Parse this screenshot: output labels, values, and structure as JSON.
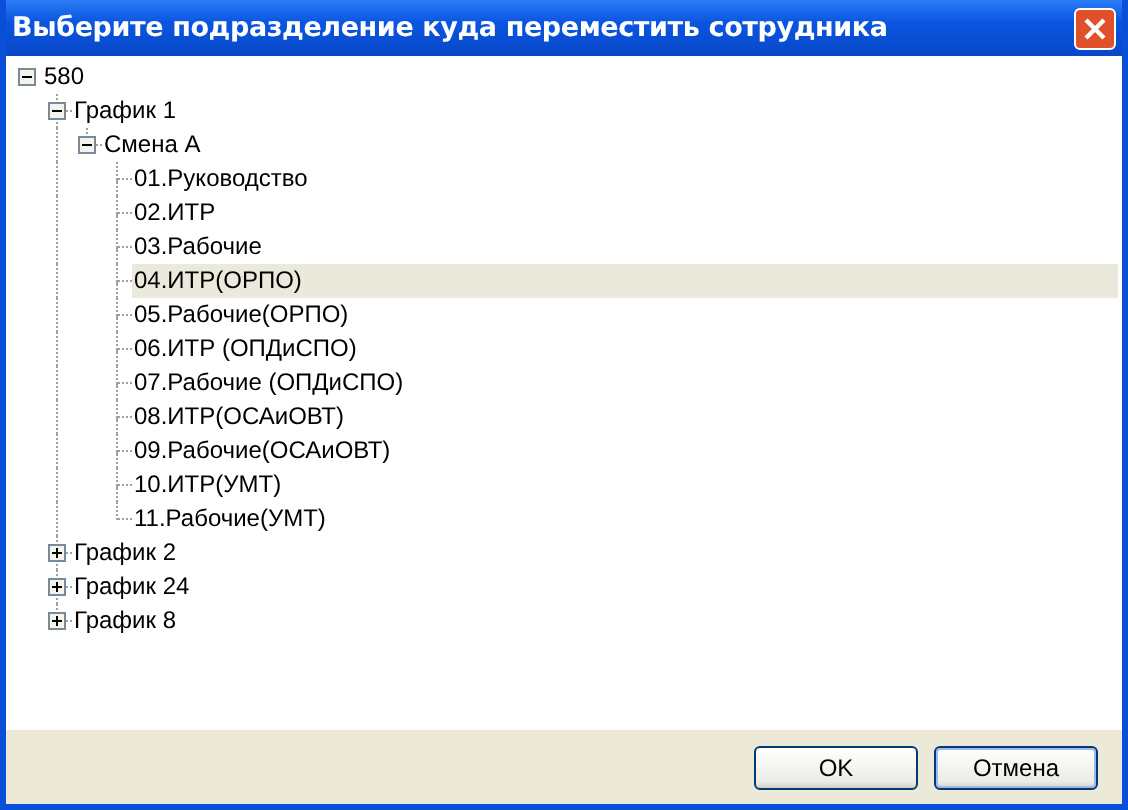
{
  "window": {
    "title": "Выберите подразделение куда переместить сотрудника"
  },
  "tree": [
    {
      "label": "580",
      "expanded": true,
      "selected": false,
      "children": [
        {
          "label": "График 1",
          "expanded": true,
          "selected": false,
          "children": [
            {
              "label": "Смена А",
              "expanded": true,
              "selected": false,
              "children": [
                {
                  "label": "01.Руководство",
                  "selected": false
                },
                {
                  "label": "02.ИТР",
                  "selected": false
                },
                {
                  "label": "03.Рабочие",
                  "selected": false
                },
                {
                  "label": "04.ИТР(ОРПО)",
                  "selected": true
                },
                {
                  "label": "05.Рабочие(ОРПО)",
                  "selected": false
                },
                {
                  "label": "06.ИТР (ОПДиСПО)",
                  "selected": false
                },
                {
                  "label": "07.Рабочие (ОПДиСПО)",
                  "selected": false
                },
                {
                  "label": "08.ИТР(ОСАиОВТ)",
                  "selected": false
                },
                {
                  "label": "09.Рабочие(ОСАиОВТ)",
                  "selected": false
                },
                {
                  "label": "10.ИТР(УМТ)",
                  "selected": false
                },
                {
                  "label": "11.Рабочие(УМТ)",
                  "selected": false
                }
              ]
            }
          ]
        },
        {
          "label": "График 2",
          "expanded": false,
          "selected": false
        },
        {
          "label": "График 24",
          "expanded": false,
          "selected": false
        },
        {
          "label": "График 8",
          "expanded": false,
          "selected": false
        }
      ]
    }
  ],
  "buttons": [
    "OK",
    "Отмена"
  ]
}
